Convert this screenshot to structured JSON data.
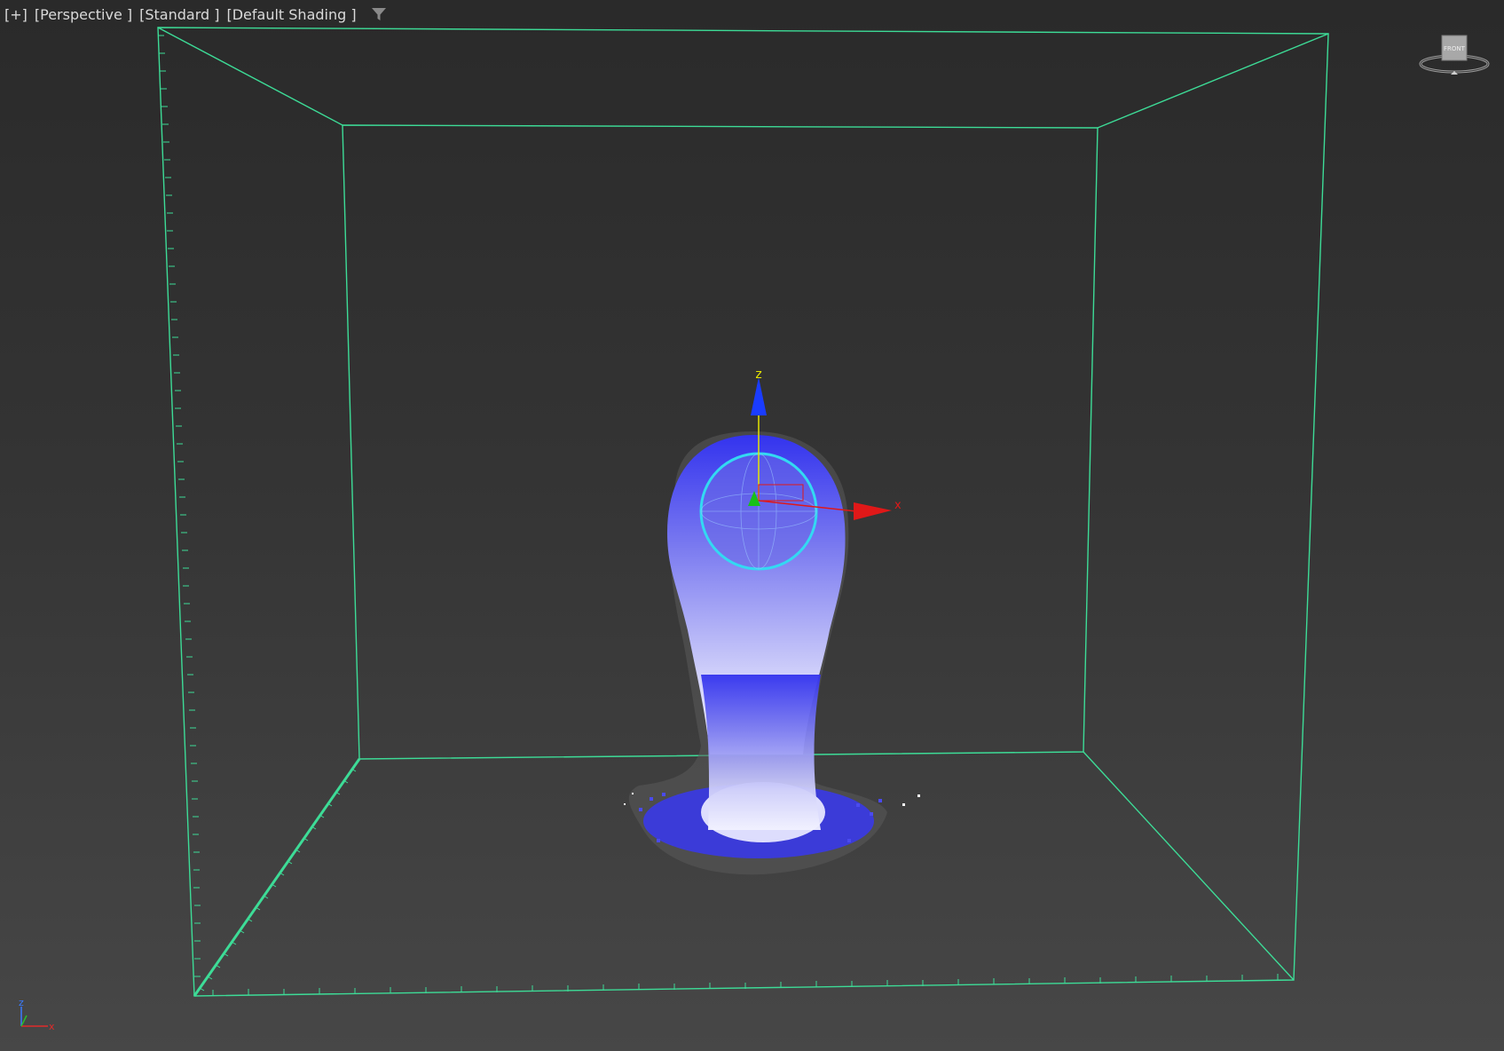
{
  "viewport": {
    "menu_label": "[+]",
    "view_label": "[Perspective ]",
    "preset_label": "[Standard ]",
    "shading_label": "[Default Shading ]",
    "filter_icon": "funnel-filter-icon"
  },
  "viewcube": {
    "face_label": "FRONT",
    "icon": "viewcube-icon"
  },
  "gizmo": {
    "z_label": "z",
    "x_label": "x"
  },
  "axis_tripod": {
    "z_label": "z",
    "x_label": "x"
  },
  "colors": {
    "bounding_box": "#3ddc97",
    "particles_top": "#2a2ae6",
    "particles_bottom": "#e6e6ff",
    "selection_ring": "#33d9f2",
    "gizmo_z": "#1a3cff",
    "gizmo_x": "#e01818",
    "gizmo_y": "#18c018",
    "gizmo_label": "#e6e600"
  }
}
